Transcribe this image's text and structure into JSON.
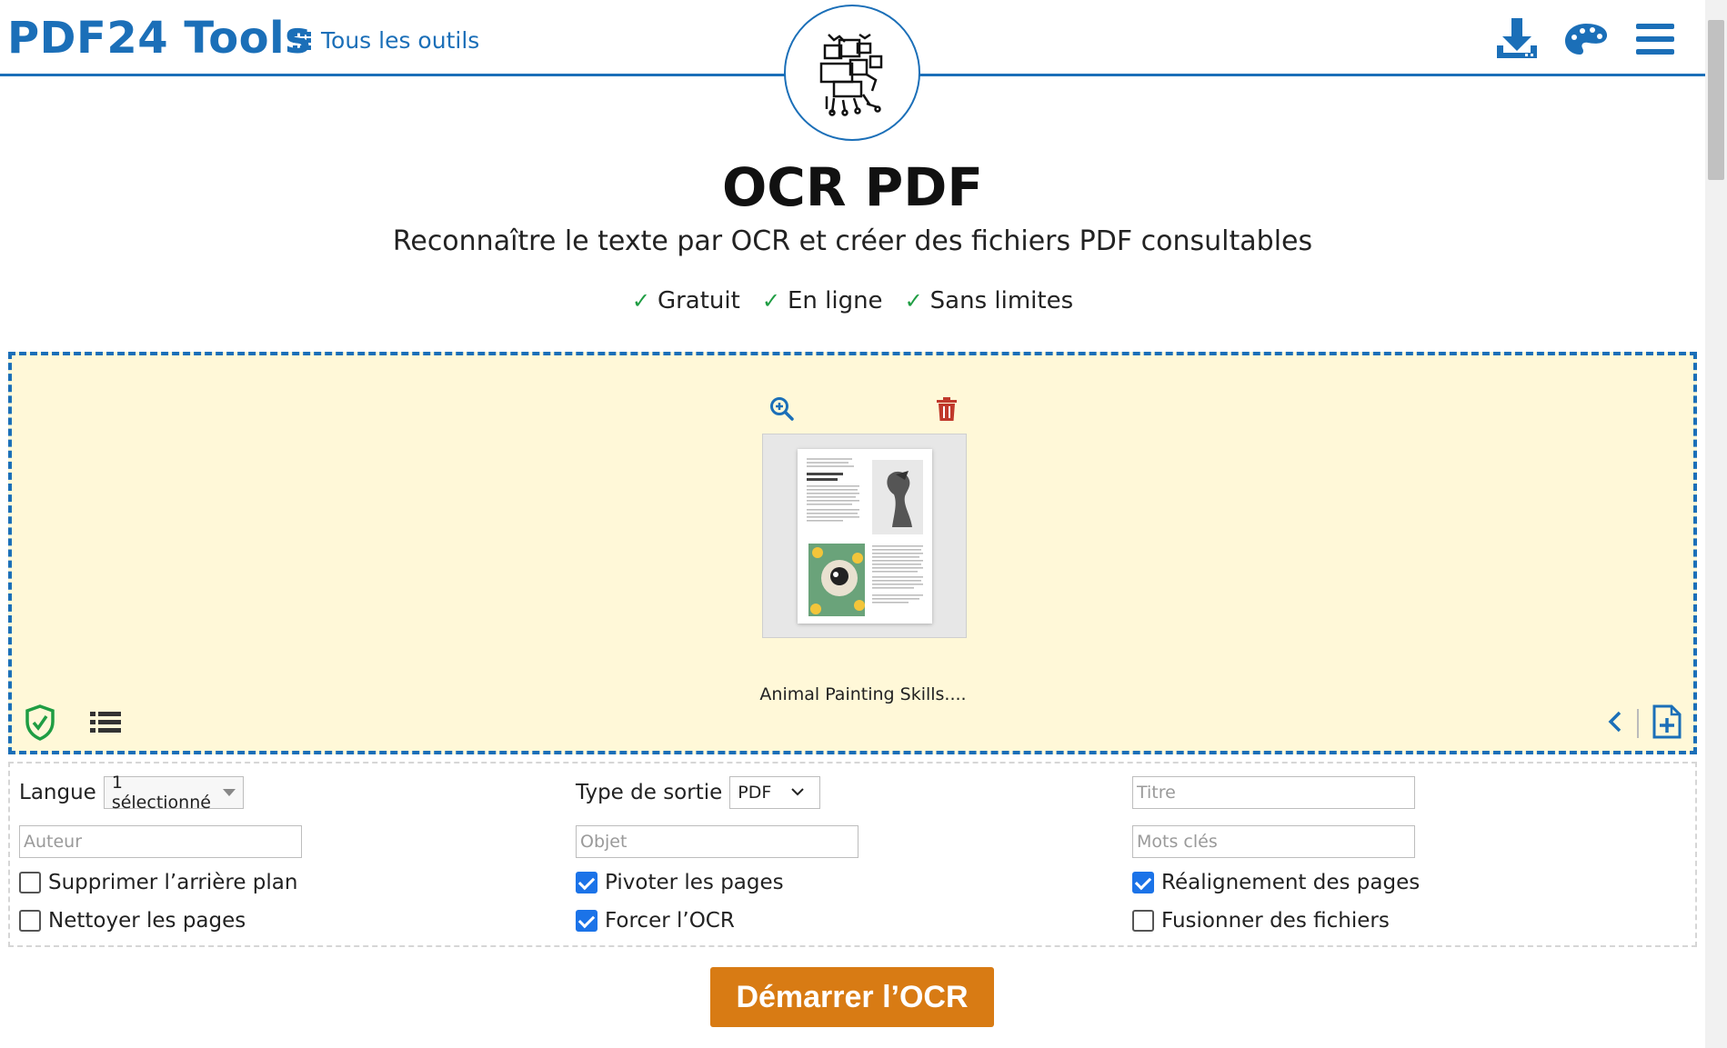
{
  "header": {
    "brand": "PDF24 Tools",
    "all_tools_label": "Tous les outils",
    "icons": [
      "download-icon",
      "palette-icon",
      "menu-icon"
    ]
  },
  "hero": {
    "title": "OCR PDF",
    "subtitle": "Reconnaître le texte par OCR et créer des fichiers PDF consultables",
    "features": [
      "Gratuit",
      "En ligne",
      "Sans limites"
    ]
  },
  "dropzone": {
    "file_name": "Animal Painting Skills....",
    "icons": [
      "zoom-in-icon",
      "trash-icon",
      "shield-check-icon",
      "list-icon",
      "chevron-left-icon",
      "add-file-icon"
    ]
  },
  "options": {
    "language_label": "Langue",
    "language_value": "1 sélectionné",
    "output_type_label": "Type de sortie",
    "output_type_value": "PDF",
    "placeholders": {
      "title": "Titre",
      "author": "Auteur",
      "subject": "Objet",
      "keywords": "Mots clés"
    },
    "checkboxes": {
      "remove_background": {
        "label": "Supprimer l’arrière plan",
        "checked": false
      },
      "rotate_pages": {
        "label": "Pivoter les pages",
        "checked": true
      },
      "deskew_pages": {
        "label": "Réalignement des pages",
        "checked": true
      },
      "clean_pages": {
        "label": "Nettoyer les pages",
        "checked": false
      },
      "force_ocr": {
        "label": "Forcer l’OCR",
        "checked": true
      },
      "merge_files": {
        "label": "Fusionner des fichiers",
        "checked": false
      }
    }
  },
  "actions": {
    "start_label": "Démarrer l’OCR"
  },
  "colors": {
    "brand_blue": "#1b6fb8",
    "dropzone_bg": "#fff8d8",
    "start_button": "#d87b14",
    "check_green": "#1f9d43",
    "trash_red": "#c0392b"
  }
}
